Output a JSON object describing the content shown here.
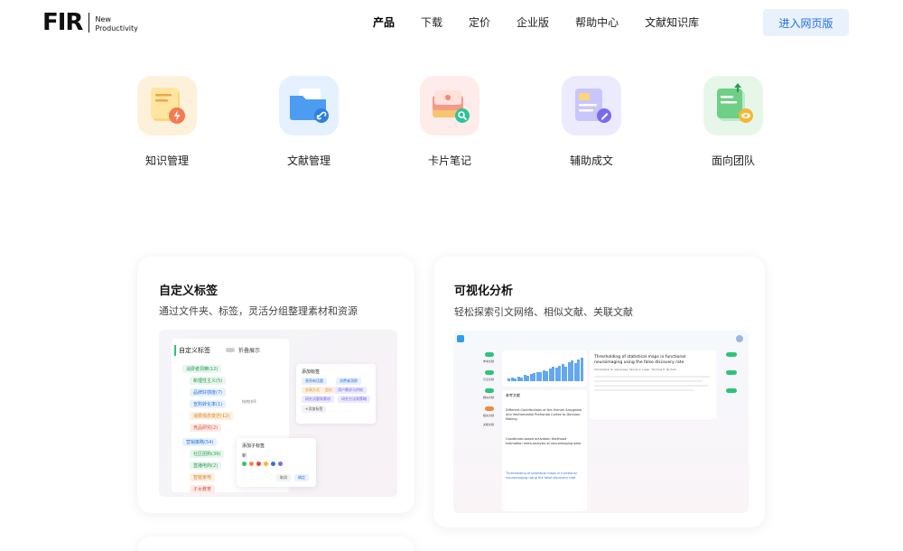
{
  "header": {
    "logo_mark": "FIR",
    "logo_tagline_1": "New",
    "logo_tagline_2": "Productivity",
    "nav": [
      "产品",
      "下载",
      "定价",
      "企业版",
      "帮助中心",
      "文献知识库"
    ],
    "enter_label": "进入网页版"
  },
  "features": [
    {
      "label": "知识管理",
      "icon": "notebook-bolt-icon"
    },
    {
      "label": "文献管理",
      "icon": "folder-link-icon"
    },
    {
      "label": "卡片笔记",
      "icon": "card-stack-search-icon"
    },
    {
      "label": "辅助成文",
      "icon": "document-pen-icon"
    },
    {
      "label": "面向团队",
      "icon": "team-document-eye-icon"
    }
  ],
  "cards": {
    "tags": {
      "title": "自定义标签",
      "subtitle": "通过文件夹、标签，灵活分组整理素材和资源",
      "panel_title": "自定义标签",
      "toggle_label": "折叠展示",
      "tree": [
        "消费者洞察(12)",
        "新理性主义(5)",
        "品牌好感度(7)",
        "宣购转化率(1)",
        "消费观念变迁(12)",
        "竞品研究(2)",
        "营销策略(54)",
        "社区团购(39)",
        "直播电商(2)",
        "智能家电",
        "子女教育"
      ],
      "drag_label": "拖拽排序",
      "add_tag_title": "添加标签",
      "tag_chips": [
        "营养新话题",
        "消费者洞察",
        "交易方式",
        "定价",
        "用户需求与供给",
        "研究试题和素材",
        "研究方法和策略"
      ],
      "add_tag_link": "+添加标签",
      "sub_tag_title": "添加子标签",
      "sub_tag_value": "新",
      "cancel": "取消",
      "confirm": "确定"
    },
    "viz": {
      "title": "可视化分析",
      "subtitle": "轻松探索引文网络、相似文献、关联文献",
      "paper_title": "Thresholding of statistical maps in functional neuroimaging using the false discovery rate",
      "paper_authors": "Christopher R. Genovese, Nicole A. Lazar, Thomas E. Nichols",
      "ref_heading": "参考文献",
      "references": [
        "Different Contributions of the Human Amygdala and Ventromedial Prefrontal Cortex to Decision-Making",
        "Coordinate-based activation likelihood estimation meta-analysis of neuroimaging data",
        "Thresholding of statistical maps in functional neuroimaging using the false discovery rate"
      ],
      "side_tabs": [
        "参考文献",
        "引证文献",
        "相似文献",
        "相关文献",
        "关联文献"
      ],
      "bar_values": [
        3,
        5,
        4,
        6,
        5,
        8,
        7,
        9,
        10,
        12,
        11,
        14,
        13,
        16,
        18,
        17,
        20,
        22,
        19,
        24,
        26,
        23,
        28,
        30
      ]
    }
  },
  "colors": {
    "accent": "#1f6fe5",
    "chart_bar": "#63a7ee"
  }
}
